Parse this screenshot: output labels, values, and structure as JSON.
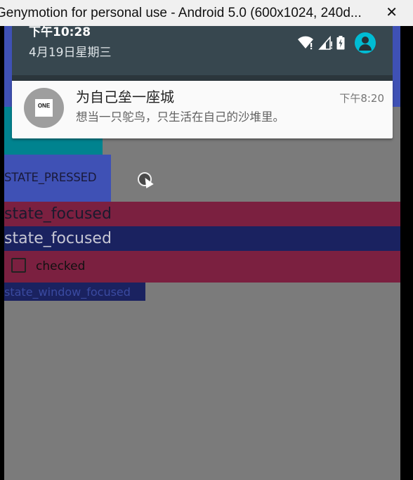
{
  "window": {
    "title": "Genymotion for personal use - Android 5.0 (600x1024, 240d...",
    "close_glyph": "✕"
  },
  "status_bar": {
    "time": "下午10:28",
    "date": "4月19日星期三",
    "icons": [
      "wifi-icon",
      "signal-icon",
      "battery-icon",
      "avatar-icon"
    ],
    "avatar_color": "#00bcd4"
  },
  "notification": {
    "app_icon_text": "ONE",
    "title": "为自己垒一座城",
    "text": "想当一只鸵鸟，只生活在自己的沙堆里。",
    "time": "下午8:20"
  },
  "states": {
    "pressed": "STATE_PRESSED",
    "focused_1": "state_focused",
    "focused_2": "state_focused",
    "checked": "checked",
    "window_focused": "state_window_focused"
  },
  "colors": {
    "header": "#3f51b5",
    "cyan": "#00838f",
    "crimson": "#7b2040",
    "navy": "#1a2260",
    "background": "#7b7b7b"
  }
}
